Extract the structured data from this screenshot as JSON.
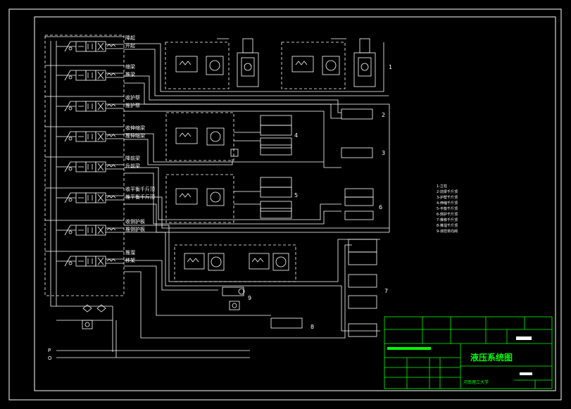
{
  "colors": {
    "background": "#000000",
    "line": "#ffffff",
    "title_block": "#00ff00",
    "frame": "#ffffff"
  },
  "valve_labels": [
    {
      "upper": "降起",
      "lower": "升起"
    },
    {
      "upper": "缩梁",
      "lower": "推梁"
    },
    {
      "upper": "收护帮",
      "lower": "推护帮"
    },
    {
      "upper": "收伸缩梁",
      "lower": "推伸缩梁"
    },
    {
      "upper": "降前梁",
      "lower": "升前梁"
    },
    {
      "upper": "收平衡千斤顶",
      "lower": "推平衡千斤顶"
    },
    {
      "upper": "收侧护板",
      "lower": "推侧护板"
    },
    {
      "upper": "推溜",
      "lower": "移架"
    }
  ],
  "callouts": [
    "1",
    "2",
    "3",
    "4",
    "5",
    "6",
    "7",
    "8",
    "9"
  ],
  "port_labels": [
    "P",
    "O"
  ],
  "legend": [
    "1-立柱",
    "2-前梁千斤顶",
    "3-护帮千斤顶",
    "4-伸缩千斤顶",
    "5-平衡千斤顶",
    "6-侧护千斤顶",
    "7-推移千斤顶",
    "8-推溜千斤顶",
    "9-液控单向阀"
  ],
  "title_block": {
    "title": "液压系统图",
    "school": "河南理工大学"
  }
}
